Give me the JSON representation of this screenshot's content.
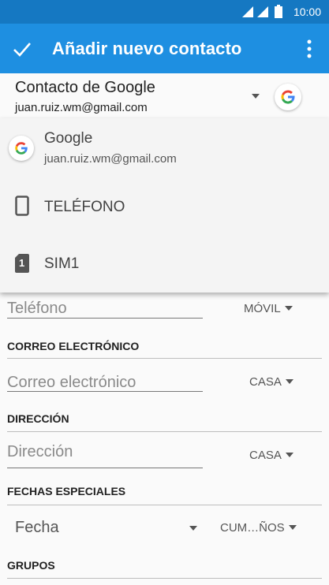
{
  "status_bar": {
    "time": "10:00"
  },
  "app_bar": {
    "title": "Añadir nuevo contacto"
  },
  "account": {
    "name": "Contacto de Google",
    "email": "juan.ruiz.wm@gmail.com"
  },
  "dropdown": {
    "google": {
      "name": "Google",
      "email": "juan.ruiz.wm@gmail.com"
    },
    "phone_label": "TELÉFONO",
    "sim_label": "SIM1",
    "sim_badge": "1"
  },
  "form": {
    "phone": {
      "placeholder": "Teléfono",
      "type": "MÓVIL"
    },
    "email": {
      "section": "CORREO ELECTRÓNICO",
      "placeholder": "Correo electrónico",
      "type": "CASA"
    },
    "address": {
      "section": "DIRECCIÓN",
      "placeholder": "Dirección",
      "type": "CASA"
    },
    "dates": {
      "section": "FECHAS ESPECIALES",
      "placeholder": "Fecha",
      "type": "CUM…ÑOS"
    },
    "groups": {
      "section": "GRUPOS"
    }
  },
  "colors": {
    "status_bar": "#1578c2",
    "app_bar": "#1e8fe1"
  }
}
